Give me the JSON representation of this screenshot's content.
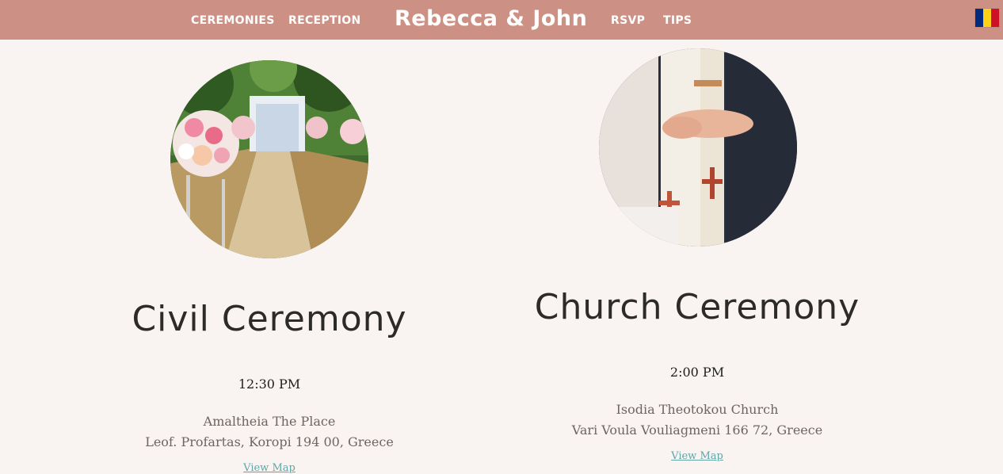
{
  "header": {
    "brand": "Rebecca & John",
    "nav": {
      "ceremonies": "CEREMONIES",
      "reception": "RECEPTION",
      "rsvp": "RSVP",
      "tips": "TIPS"
    },
    "flag_colors": [
      "#002b7f",
      "#fcd116",
      "#ce1126"
    ]
  },
  "ceremonies": [
    {
      "title": "Civil Ceremony",
      "time": "12:30 PM",
      "venue": "Amaltheia The Place",
      "address": "Leof. Profartas, Koropi 194 00, Greece",
      "map_label": "View Map"
    },
    {
      "title": "Church Ceremony",
      "time": "2:00 PM",
      "venue": "Isodia Theotokou Church",
      "address": "Vari Voula Vouliagmeni 166 72, Greece",
      "map_label": "View Map"
    }
  ],
  "colors": {
    "header_bg": "#cc9184",
    "page_bg": "#f9f3f1",
    "link": "#5fa6a8"
  }
}
